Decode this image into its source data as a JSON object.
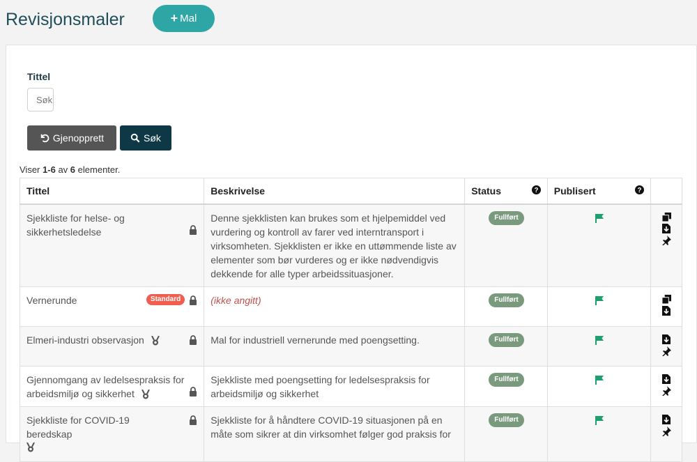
{
  "header": {
    "title": "Revisjonsmaler",
    "add_label": "Mal"
  },
  "filter": {
    "title_label": "Tittel",
    "search_placeholder": "Søk",
    "reset_label": "Gjenopprett",
    "search_label": "Søk"
  },
  "results": {
    "prefix": "Viser",
    "range": "1-6",
    "of": "av",
    "total": "6",
    "suffix": "elementer."
  },
  "columns": {
    "title": "Tittel",
    "description": "Beskrivelse",
    "status": "Status",
    "published": "Publisert"
  },
  "rows": [
    {
      "title": "Sjekkliste for helse- og sikkerhetsledelse",
      "description": "Denne sjekklisten kan brukes som et hjelpemiddel ved vurdering og kontroll av farer ved interntransport i virksomheten. Sjekklisten er ikke en uttømmende liste av elementer som bør vurderes og er ikke nødvendigvis dekkende for alle typer arbeidssituasjoner.",
      "status": "Fullført"
    },
    {
      "title": "Vernerunde",
      "badge": "Standard",
      "description": "(ikke angitt)",
      "status": "Fullført"
    },
    {
      "title": "Elmeri-industri observasjon",
      "description": "Mal for industriell vernerunde med poengsetting.",
      "status": "Fullført"
    },
    {
      "title": "Gjennomgang av ledelsespraksis for arbeidsmiljø og sikkerhet",
      "description": "Sjekkliste med poengsetting for ledelsespraksis for arbeidsmiljø og sikkerhet",
      "status": "Fullført"
    },
    {
      "title": "Sjekkliste for COVID-19 beredskap",
      "description": "Sjekkliste for å håndtere COVID-19 situasjonen på en måte som sikrer at din virksomhet følger god praksis for",
      "status": "Fullført"
    }
  ],
  "colors": {
    "accent": "#2ea6a6",
    "flag": "#1f9e6e",
    "badge": "#ef5e4f",
    "status": "#7a9a7e"
  },
  "icons": [
    "plus-icon",
    "undo-icon",
    "search-icon",
    "help-icon",
    "lock-icon",
    "medal-icon",
    "flag-icon",
    "copy-icon",
    "download-icon",
    "pin-icon"
  ]
}
